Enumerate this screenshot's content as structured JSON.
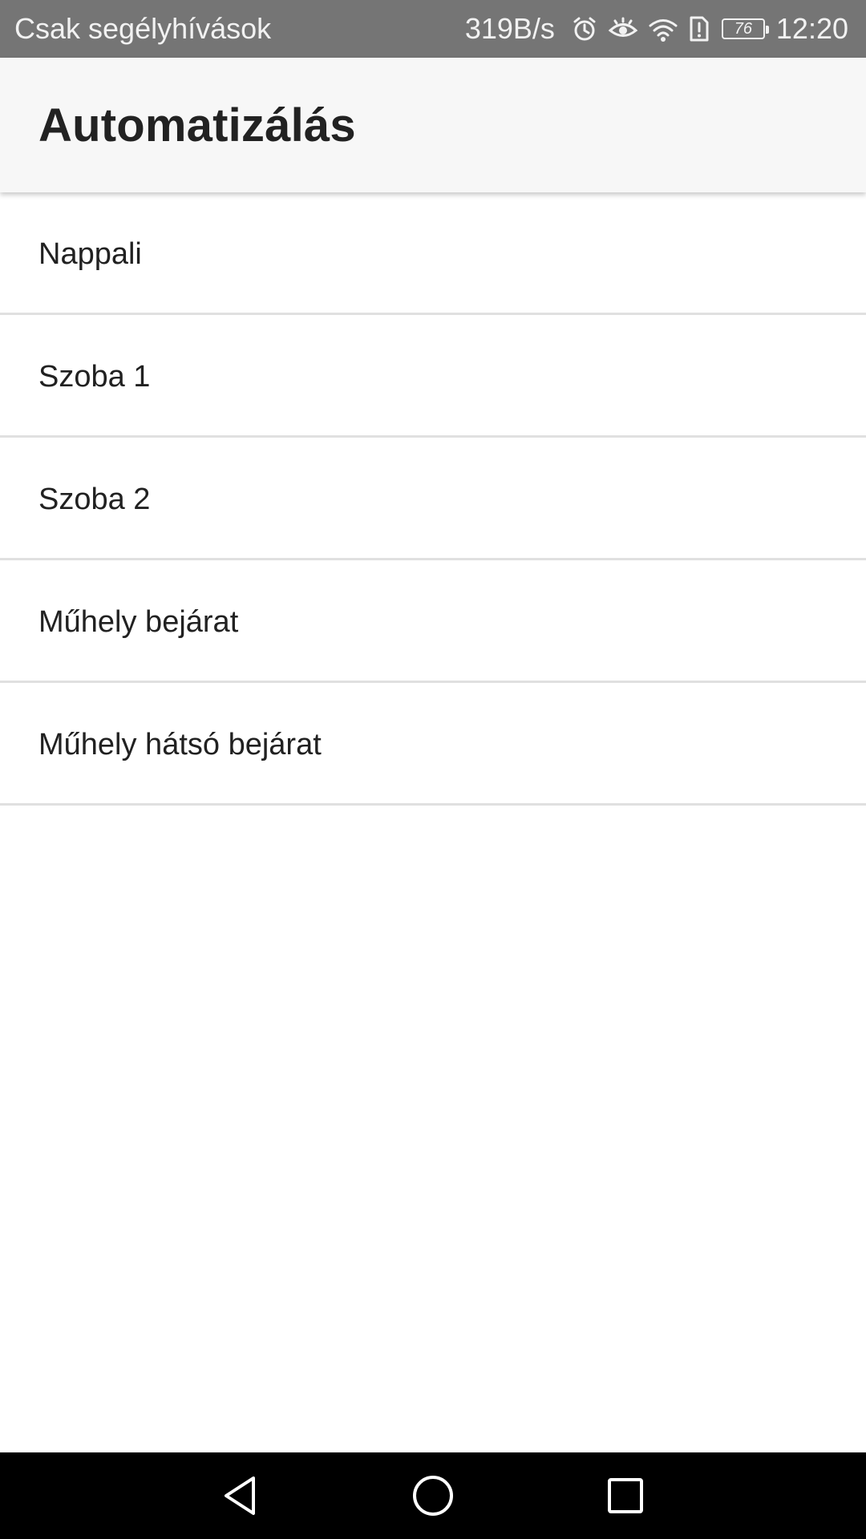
{
  "status_bar": {
    "carrier_text": "Csak segélyhívások",
    "net_speed": "319B/s",
    "icons": [
      "alarm-icon",
      "eye-comfort-icon",
      "wifi-icon",
      "sim-alert-icon",
      "battery-icon"
    ],
    "battery_level": "76",
    "time": "12:20"
  },
  "app_bar": {
    "title": "Automatizálás"
  },
  "list": {
    "items": [
      {
        "label": "Nappali"
      },
      {
        "label": "Szoba 1"
      },
      {
        "label": "Szoba 2"
      },
      {
        "label": "Műhely bejárat"
      },
      {
        "label": "Műhely hátsó bejárat"
      }
    ]
  },
  "nav_bar": {
    "buttons": [
      "back-icon",
      "home-icon",
      "recents-icon"
    ]
  },
  "colors": {
    "status_bar_bg": "#757575",
    "app_bar_bg": "#f7f7f7",
    "divider": "#e0e0e0",
    "nav_bar_bg": "#000000"
  }
}
